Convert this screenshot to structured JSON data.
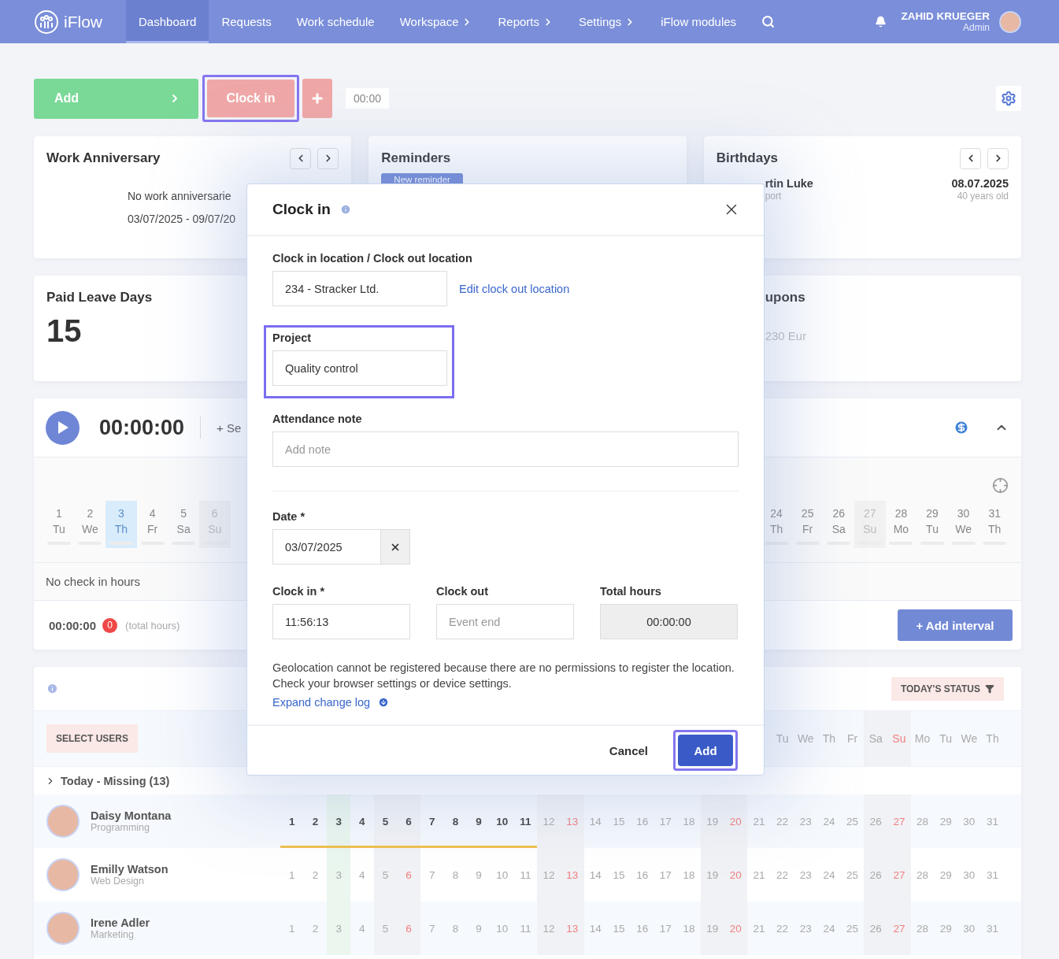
{
  "nav": {
    "logo": "iFlow",
    "items": [
      {
        "label": "Dashboard",
        "selected": true,
        "has_submenu": false
      },
      {
        "label": "Requests",
        "selected": false,
        "has_submenu": false
      },
      {
        "label": "Work schedule",
        "selected": false,
        "has_submenu": false
      },
      {
        "label": "Workspace",
        "selected": false,
        "has_submenu": true
      },
      {
        "label": "Reports",
        "selected": false,
        "has_submenu": true
      },
      {
        "label": "Settings",
        "selected": false,
        "has_submenu": true
      },
      {
        "label": "iFlow modules",
        "selected": false,
        "has_submenu": false
      }
    ],
    "user": {
      "name": "ZAHID KRUEGER",
      "role": "Admin"
    }
  },
  "toolbar": {
    "add_label": "Add",
    "clock_in": {
      "label": "Clock in",
      "focused": true
    },
    "timer": "00:00"
  },
  "work_anniversary": {
    "title": "Work Anniversary",
    "message": "No work anniversarie",
    "range": "03/07/2025 - 09/07/20"
  },
  "reminders": {
    "title": "Reminders",
    "button": "New reminder"
  },
  "birthdays": {
    "title": "Birthdays",
    "person": "rtin Luke",
    "department": "port",
    "date": "08.07.2025",
    "age": "40 years old"
  },
  "paid_leave": {
    "title": "Paid Leave Days",
    "value": "15"
  },
  "coupons": {
    "title": "upons",
    "value": "230 Eur"
  },
  "timer": {
    "time": "00:00:00",
    "series_label": "+ Se",
    "days_start": [
      {
        "day": "1",
        "weekday": "Tu",
        "kind": "weekday",
        "selected": false
      },
      {
        "day": "2",
        "weekday": "We",
        "kind": "weekday",
        "selected": false
      },
      {
        "day": "3",
        "weekday": "Th",
        "kind": "weekday",
        "selected": true
      },
      {
        "day": "4",
        "weekday": "Fr",
        "kind": "weekday",
        "selected": false
      },
      {
        "day": "5",
        "weekday": "Sa",
        "kind": "saturday",
        "selected": false
      },
      {
        "day": "6",
        "weekday": "Su",
        "kind": "sunday",
        "selected": false
      }
    ],
    "days_end": [
      {
        "day": "24",
        "weekday": "Th",
        "kind": "weekday",
        "selected": false
      },
      {
        "day": "25",
        "weekday": "Fr",
        "kind": "weekday",
        "selected": false
      },
      {
        "day": "26",
        "weekday": "Sa",
        "kind": "saturday",
        "selected": false
      },
      {
        "day": "27",
        "weekday": "Su",
        "kind": "sunday",
        "selected": false
      },
      {
        "day": "28",
        "weekday": "Mo",
        "kind": "weekday",
        "selected": false
      },
      {
        "day": "29",
        "weekday": "Tu",
        "kind": "weekday",
        "selected": false
      },
      {
        "day": "30",
        "weekday": "We",
        "kind": "weekday",
        "selected": false
      },
      {
        "day": "31",
        "weekday": "Th",
        "kind": "weekday",
        "selected": false
      }
    ],
    "no_hours": "No check in hours",
    "total": "00:00:00",
    "badge": "0",
    "total_label": "(total hours)",
    "add_interval": "+ Add interval"
  },
  "table": {
    "status_button": "TODAY'S STATUS",
    "select_users": "SELECT USERS",
    "day_columns": [
      {
        "kind": "weekday"
      },
      {
        "kind": "weekday"
      },
      {
        "kind": "today"
      },
      {
        "kind": "weekday"
      },
      {
        "kind": "saturday"
      },
      {
        "kind": "sunday"
      },
      {
        "kind": "weekday"
      },
      {
        "kind": "weekday"
      },
      {
        "kind": "weekday"
      },
      {
        "kind": "weekday"
      },
      {
        "kind": "weekday"
      },
      {
        "kind": "saturday"
      },
      {
        "kind": "sunday"
      },
      {
        "kind": "weekday"
      },
      {
        "kind": "weekday"
      },
      {
        "kind": "weekday"
      },
      {
        "kind": "weekday"
      },
      {
        "kind": "weekday"
      },
      {
        "kind": "saturday"
      },
      {
        "kind": "sunday"
      },
      {
        "kind": "weekday"
      },
      {
        "kind": "weekday"
      },
      {
        "kind": "weekday"
      },
      {
        "kind": "weekday"
      },
      {
        "kind": "weekday"
      },
      {
        "kind": "saturday"
      },
      {
        "kind": "sunday"
      },
      {
        "kind": "weekday"
      },
      {
        "kind": "weekday"
      },
      {
        "kind": "weekday"
      },
      {
        "kind": "weekday"
      }
    ],
    "weekday_headers": [
      {
        "label": "Tu",
        "kind": "weekday"
      },
      {
        "label": "We",
        "kind": "weekday"
      },
      {
        "label": "Th",
        "kind": "weekday"
      },
      {
        "label": "Fr",
        "kind": "weekday"
      },
      {
        "label": "Sa",
        "kind": "saturday"
      },
      {
        "label": "Su",
        "kind": "sunday"
      },
      {
        "label": "Mo",
        "kind": "weekday"
      },
      {
        "label": "Tu",
        "kind": "weekday"
      },
      {
        "label": "We",
        "kind": "weekday"
      },
      {
        "label": "Th",
        "kind": "weekday"
      }
    ],
    "group": {
      "label": "Today - Missing (13)",
      "expanded": false
    },
    "users": [
      {
        "name": "Daisy Montana",
        "department": "Programming",
        "days": [
          "1",
          "2",
          "3",
          "4",
          "5",
          "6",
          "7",
          "8",
          "9",
          "10",
          "11",
          "12",
          "13",
          "14",
          "15",
          "16",
          "17",
          "18",
          "19",
          "20",
          "21",
          "22",
          "23",
          "24",
          "25",
          "26",
          "27",
          "28",
          "29",
          "30",
          "31"
        ],
        "worked": [
          true,
          true,
          true,
          true,
          true,
          true,
          true,
          true,
          true,
          true,
          true,
          false,
          false,
          false,
          false,
          false,
          false,
          false,
          false,
          false,
          false,
          false,
          false,
          false,
          false,
          false,
          false,
          false,
          false,
          false,
          false
        ]
      },
      {
        "name": "Emilly Watson",
        "department": "Web Design",
        "days": [
          "1",
          "2",
          "3",
          "4",
          "5",
          "6",
          "7",
          "8",
          "9",
          "10",
          "11",
          "12",
          "13",
          "14",
          "15",
          "16",
          "17",
          "18",
          "19",
          "20",
          "21",
          "22",
          "23",
          "24",
          "25",
          "26",
          "27",
          "28",
          "29",
          "30",
          "31"
        ],
        "worked": [
          false,
          false,
          false,
          false,
          false,
          false,
          false,
          false,
          false,
          false,
          false,
          false,
          false,
          false,
          false,
          false,
          false,
          false,
          false,
          false,
          false,
          false,
          false,
          false,
          false,
          false,
          false,
          false,
          false,
          false,
          false
        ]
      },
      {
        "name": "Irene Adler",
        "department": "Marketing",
        "days": [
          "1",
          "2",
          "3",
          "4",
          "5",
          "6",
          "7",
          "8",
          "9",
          "10",
          "11",
          "12",
          "13",
          "14",
          "15",
          "16",
          "17",
          "18",
          "19",
          "20",
          "21",
          "22",
          "23",
          "24",
          "25",
          "26",
          "27",
          "28",
          "29",
          "30",
          "31"
        ],
        "worked": [
          false,
          false,
          false,
          false,
          false,
          false,
          false,
          false,
          false,
          false,
          false,
          false,
          false,
          false,
          false,
          false,
          false,
          false,
          false,
          false,
          false,
          false,
          false,
          false,
          false,
          false,
          false,
          false,
          false,
          false,
          false
        ]
      }
    ]
  },
  "modal": {
    "title": "Clock in",
    "location_label": "Clock in location / Clock out location",
    "location_value": "234 - Stracker Ltd.",
    "edit_location": "Edit clock out location",
    "project": {
      "label": "Project",
      "value": "Quality control",
      "focused": true
    },
    "note": {
      "label": "Attendance note",
      "placeholder": "Add note"
    },
    "date": {
      "label": "Date *",
      "value": "03/07/2025"
    },
    "clock_in": {
      "label": "Clock in *",
      "value": "11:56:13"
    },
    "clock_out": {
      "label": "Clock out",
      "placeholder": "Event end"
    },
    "total": {
      "label": "Total hours",
      "value": "00:00:00",
      "disabled": true
    },
    "geolocation_message": "Geolocation cannot be registered because there are no permissions to register the location. Check your browser settings or device settings.",
    "change_log": "Expand change log",
    "cancel": "Cancel",
    "submit": {
      "label": "Add",
      "focused": true
    }
  }
}
